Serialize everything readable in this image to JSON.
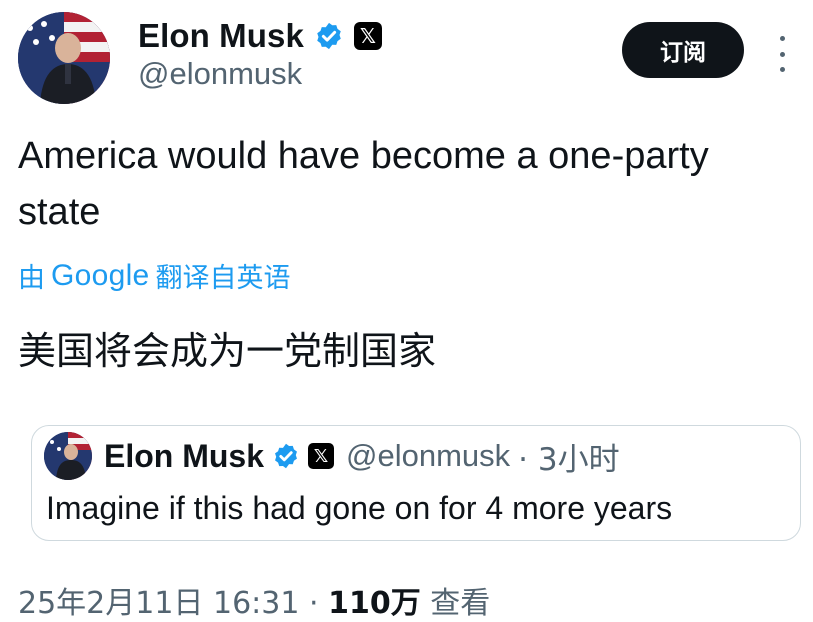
{
  "author": {
    "name": "Elon Musk",
    "handle": "@elonmusk",
    "verified_icon": "verified-check",
    "affiliate_icon": "x-logo"
  },
  "header": {
    "subscribe_label": "订阅",
    "more_icon": "more-vertical"
  },
  "tweet": {
    "text": "America would have become a one-party state",
    "translate_prefix": "由",
    "translate_brand": "Google",
    "translate_suffix": "翻译自英语",
    "translation": "美国将会成为一党制国家"
  },
  "quoted": {
    "name": "Elon Musk",
    "handle": "@elonmusk",
    "time": "· 3小时",
    "text": "Imagine if this had gone on for 4 more years"
  },
  "footer": {
    "date": "25年2月11日",
    "time": "16:31",
    "separator": "·",
    "views_count": "110万",
    "views_label": "查看"
  },
  "colors": {
    "text": "#0f1419",
    "secondary": "#536471",
    "link": "#1d9bf0",
    "verified": "#1d9bf0",
    "border": "#cfd9de"
  }
}
